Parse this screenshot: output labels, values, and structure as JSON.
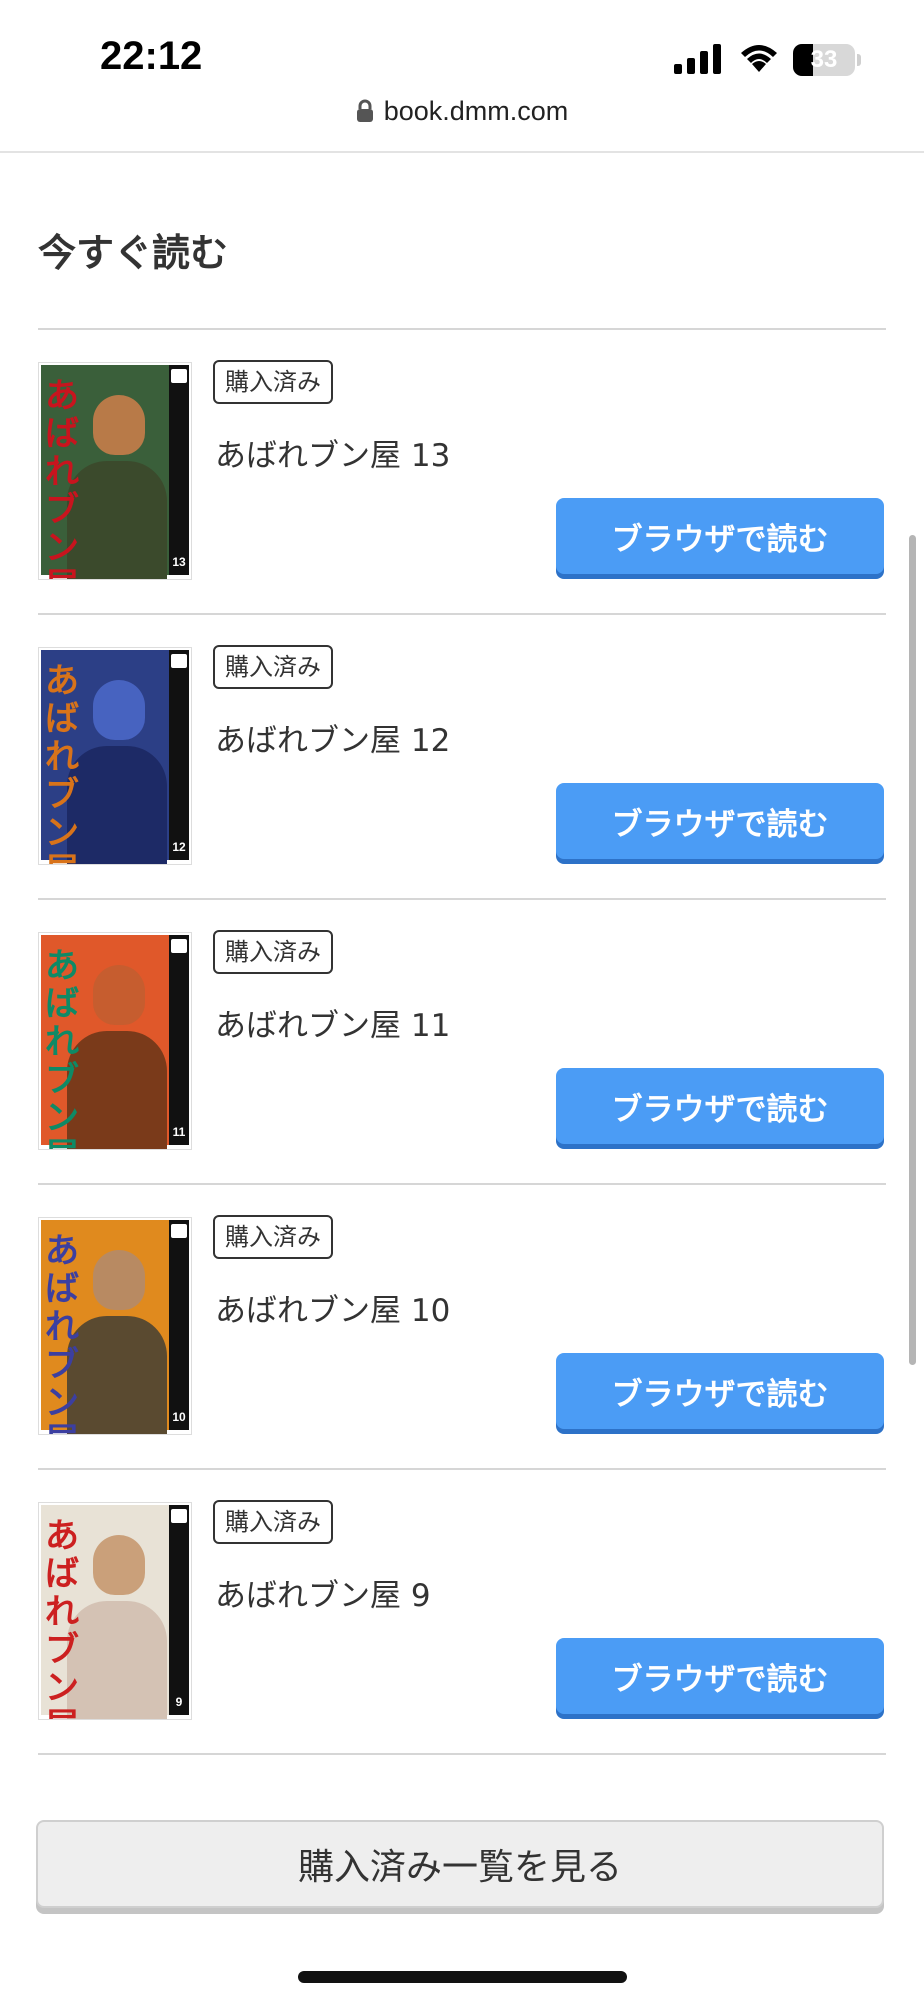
{
  "status_bar": {
    "time": "22:12",
    "battery_percent": "33",
    "battery_level": 0.33
  },
  "browser": {
    "url": "book.dmm.com",
    "lock_icon": "lock-icon"
  },
  "section": {
    "title": "今すぐ読む"
  },
  "items": [
    {
      "badge": "購入済み",
      "title": "あばれブン屋 13",
      "button": "ブラウザで読む",
      "cover": {
        "volume": "13",
        "title_color": "#c8141e",
        "bg": "#3a5f3a",
        "skin": "#b87a48",
        "suit": "#3b4a2c",
        "cover_title": "あばれブン屋"
      }
    },
    {
      "badge": "購入済み",
      "title": "あばれブン屋 12",
      "button": "ブラウザで読む",
      "cover": {
        "volume": "12",
        "title_color": "#d8731a",
        "bg": "#2c3f86",
        "skin": "#4763c0",
        "suit": "#1d2a66",
        "cover_title": "あばれブン屋"
      }
    },
    {
      "badge": "購入済み",
      "title": "あばれブン屋 11",
      "button": "ブラウザで読む",
      "cover": {
        "volume": "11",
        "title_color": "#0e8a66",
        "bg": "#e0582a",
        "skin": "#c65d2f",
        "suit": "#7a3a1a",
        "cover_title": "あばれブン屋"
      }
    },
    {
      "badge": "購入済み",
      "title": "あばれブン屋 10",
      "button": "ブラウザで読む",
      "cover": {
        "volume": "10",
        "title_color": "#3c3fa0",
        "bg": "#e08a1e",
        "skin": "#b88a62",
        "suit": "#5a4a30",
        "cover_title": "あばれブン屋"
      }
    },
    {
      "badge": "購入済み",
      "title": "あばれブン屋 9",
      "button": "ブラウザで読む",
      "cover": {
        "volume": "9",
        "title_color": "#cc2020",
        "bg": "#e8e2d6",
        "skin": "#caa07a",
        "suit": "#d4c2b4",
        "cover_title": "あばれブン屋"
      }
    }
  ],
  "footer": {
    "view_all_label": "購入済み一覧を見る"
  }
}
